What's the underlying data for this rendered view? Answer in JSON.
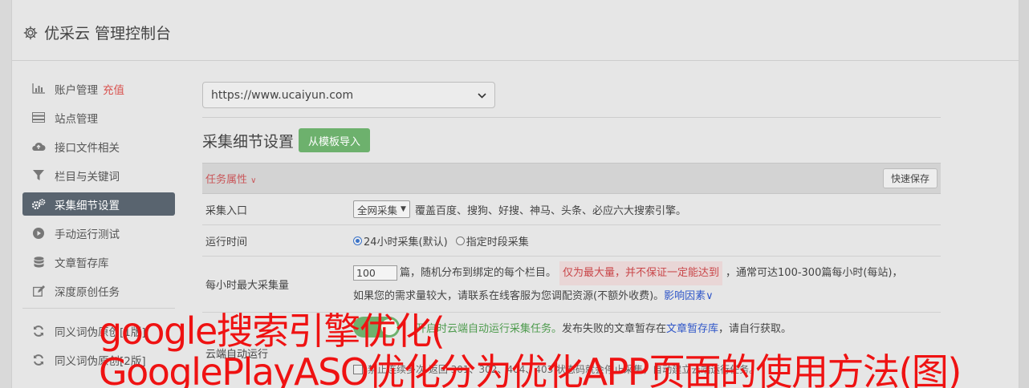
{
  "header": {
    "title": "优采云 管理控制台"
  },
  "sidebar": {
    "items": [
      {
        "label": "账户管理",
        "badge": "充值",
        "icon": "bar-chart-icon"
      },
      {
        "label": "站点管理",
        "icon": "server-icon"
      },
      {
        "label": "接口文件相关",
        "icon": "cloud-upload-icon"
      },
      {
        "label": "栏目与关键词",
        "icon": "filter-icon"
      },
      {
        "label": "采集细节设置",
        "icon": "gears-icon",
        "active": true
      },
      {
        "label": "手动运行测试",
        "icon": "play-circle-icon"
      },
      {
        "label": "文章暂存库",
        "icon": "database-icon"
      },
      {
        "label": "深度原创任务",
        "icon": "edit-icon"
      }
    ],
    "items2": [
      {
        "label": "同义词伪原创[1版]",
        "icon": "refresh-icon"
      },
      {
        "label": "同义词伪原创[2版]",
        "icon": "refresh-icon"
      }
    ]
  },
  "main": {
    "site_select": "https://www.ucaiyun.com",
    "section_title": "采集细节设置",
    "import_btn": "从模板导入",
    "task_props": "任务属性",
    "quick_save": "快速保存",
    "rows": {
      "entry": {
        "label": "采集入口",
        "select": "全网采集",
        "desc": "覆盖百度、搜狗、好搜、神马、头条、必应六大搜索引擎。"
      },
      "time": {
        "label": "运行时间",
        "opt1": "24小时采集(默认)",
        "opt2": "指定时段采集"
      },
      "max": {
        "label": "每小时最大采集量",
        "value": "100",
        "t1": "篇，随机分布到绑定的每个栏目。",
        "red": "仅为最大量，并不保证一定能达到",
        "t2": "，通常可达100-300篇每小时(每站)，",
        "t3": "如果您的需求量较大，请联系在线客服为您调配资源(不额外收费)。",
        "link": "影响因素"
      },
      "cloud": {
        "label": "云端自动运行",
        "green": "开启时云端自动运行采集任务。",
        "t1": "发布失败的文章暂存在",
        "link": "文章暂存库",
        "t2": "，请自行获取。",
        "t3": "禁止连续多次 返回 301、302、404、403 状态码就会停止采集，自动建立云端运行任务。"
      }
    }
  },
  "overlay": {
    "line1": "google搜索引擎优化(",
    "line2": "GooglePlayASO优化分为优化APP页面的使用方法(图)"
  }
}
